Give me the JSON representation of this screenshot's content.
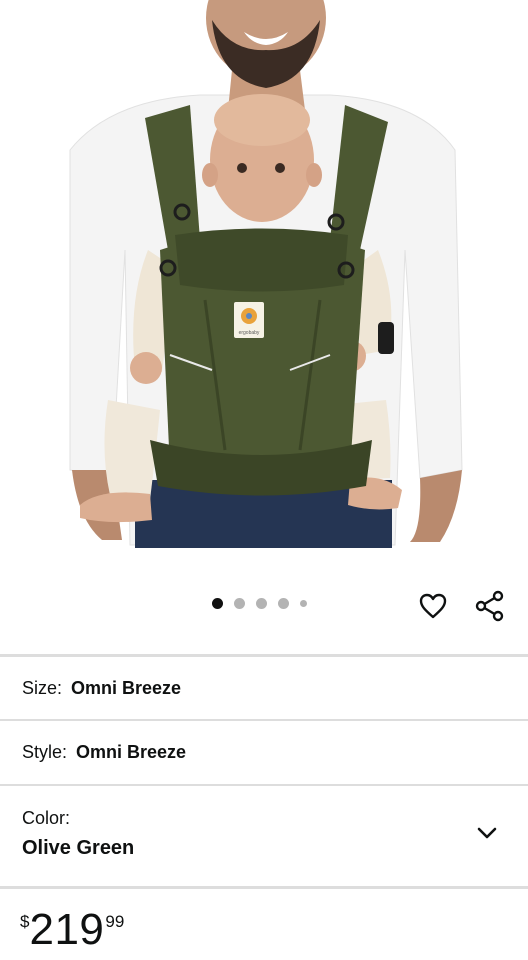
{
  "product": {
    "image": {
      "alt": "Ergobaby Omni Breeze baby carrier, Olive Green, worn by a man holding a baby",
      "logo_text": "ergobaby"
    },
    "gallery": {
      "count": 5,
      "active_index": 0
    },
    "icons": {
      "favorite": "heart-icon",
      "share": "share-icon",
      "expand": "chevron-down-icon"
    },
    "options": {
      "size": {
        "label": "Size:",
        "value": "Omni Breeze"
      },
      "style": {
        "label": "Style:",
        "value": "Omni Breeze"
      },
      "color": {
        "label": "Color:",
        "value": "Olive Green"
      }
    },
    "price": {
      "symbol": "$",
      "whole": "219",
      "fraction": "99"
    }
  },
  "colors": {
    "carrier": "#4c5832",
    "carrier_dark": "#3b4526",
    "divider": "#dddddd",
    "dot_active": "#111111",
    "dot_inactive": "#b3b3b3"
  }
}
